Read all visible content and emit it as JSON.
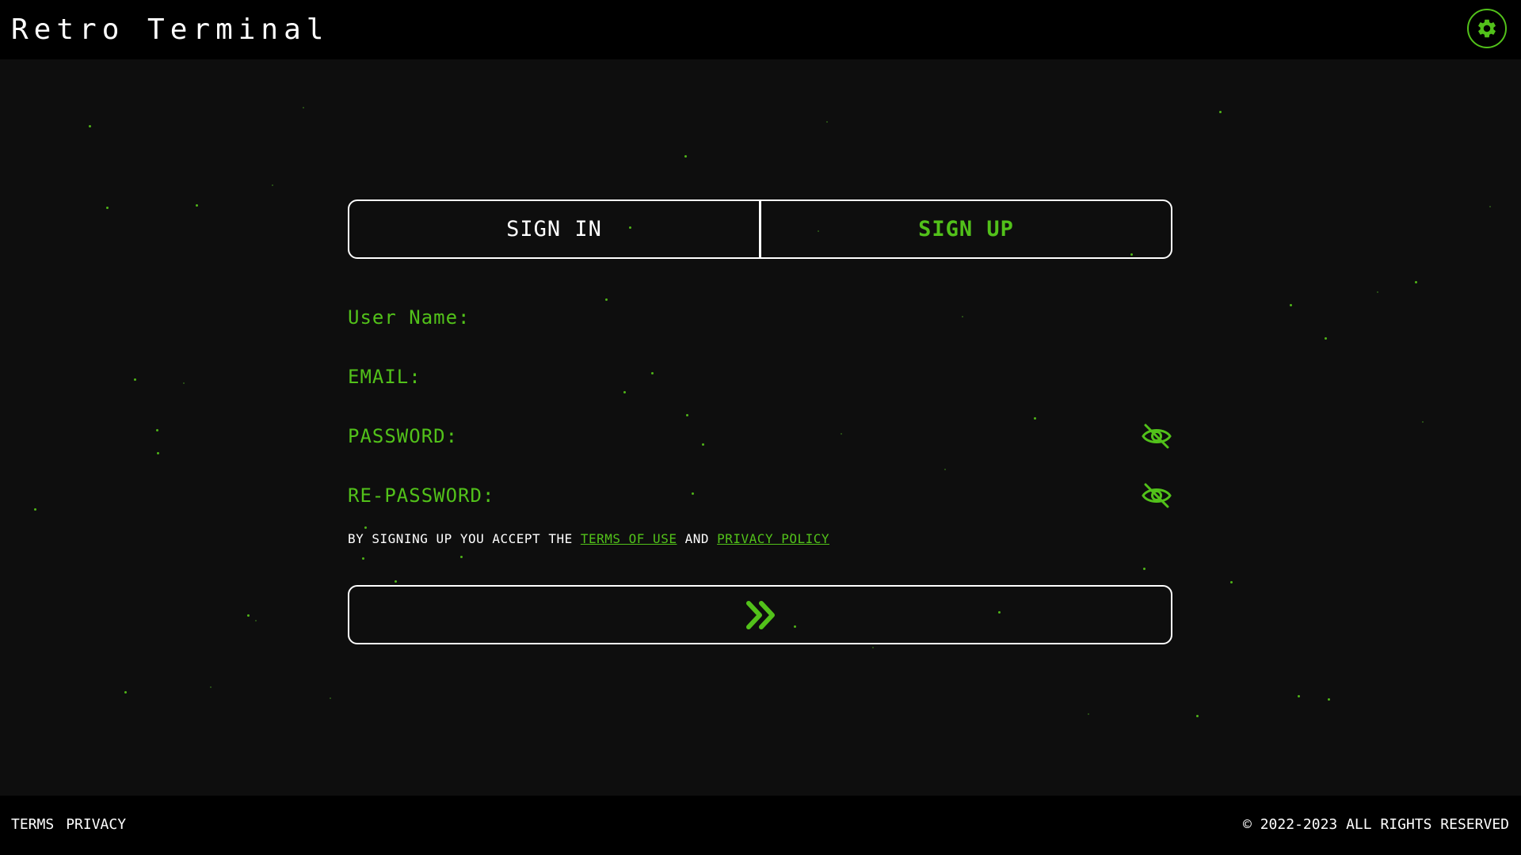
{
  "header": {
    "title": "Retro Terminal",
    "settings_icon": "gear-icon"
  },
  "colors": {
    "accent": "#52c11a",
    "background": "#0e0e0e",
    "bar": "#000000",
    "text": "#ffffff"
  },
  "tabs": {
    "signin_label": "SIGN IN",
    "signup_label": "SIGN UP",
    "active": "SIGN UP"
  },
  "fields": {
    "username_label": "User Name:",
    "username_value": "",
    "email_label": "EMAIL:",
    "email_value": "",
    "password_label": "PASSWORD:",
    "password_value": "",
    "repassword_label": "RE-PASSWORD:",
    "repassword_value": "",
    "visibility_icon": "eye-off-icon"
  },
  "terms": {
    "prefix": "BY SIGNING UP YOU ACCEPT THE",
    "terms_link": "TERMS OF USE",
    "conjunction": "AND",
    "privacy_link": "PRIVACY POLICY"
  },
  "submit": {
    "icon": "double-chevron-right-icon"
  },
  "footer": {
    "terms_label": "TERMS",
    "privacy_label": "PRIVACY",
    "copyright": "© 2022-2023 ALL RIGHTS RESERVED"
  }
}
